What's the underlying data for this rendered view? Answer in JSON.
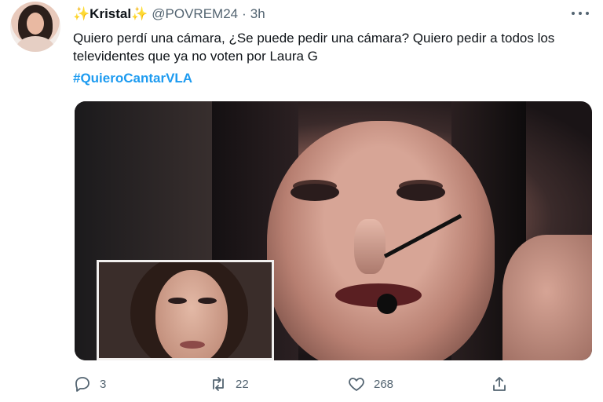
{
  "tweet": {
    "author_name": "Kristal",
    "sparkle_left": "✨",
    "sparkle_right": "✨",
    "handle": "@POVREM24",
    "separator": "·",
    "time": "3h",
    "text": "Quiero perdí una cámara, ¿Se puede pedir una cámara? Quiero pedir a todos los televidentes que ya no voten por Laura G",
    "hashtag": "#QuieroCantarVLA"
  },
  "actions": {
    "reply": {
      "icon": "reply-icon",
      "count": "3"
    },
    "retweet": {
      "icon": "retweet-icon",
      "count": "22"
    },
    "like": {
      "icon": "heart-icon",
      "count": "268"
    },
    "share": {
      "icon": "share-icon"
    }
  },
  "colors": {
    "accent": "#1d9bf0",
    "text": "#0f1419",
    "secondary": "#536471",
    "sparkle": "#f4b400"
  }
}
